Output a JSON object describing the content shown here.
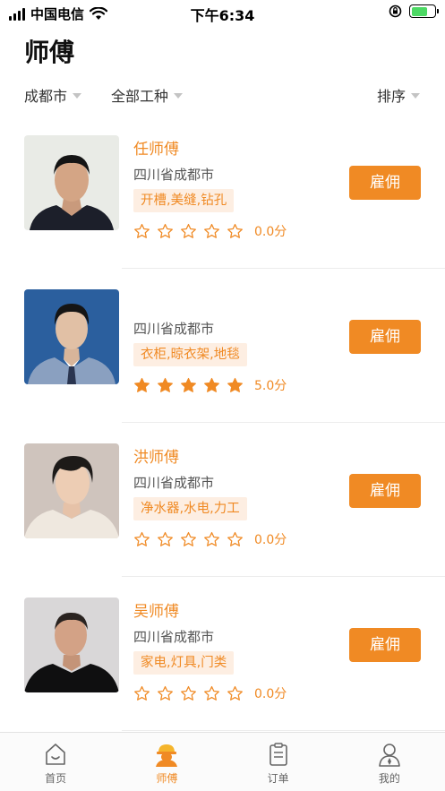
{
  "status_bar": {
    "carrier": "中国电信",
    "time": "下午6:34"
  },
  "header": {
    "title": "师傅"
  },
  "filters": {
    "city": "成都市",
    "trade": "全部工种",
    "sort": "排序"
  },
  "colors": {
    "accent": "#f08a24",
    "tag_bg": "#fdeee2"
  },
  "workers": [
    {
      "name": "任师傅",
      "location": "四川省成都市",
      "tags": "开槽,美缝,钻孔",
      "stars": 0,
      "score": "0.0分",
      "button": "雇佣"
    },
    {
      "name": "",
      "location": "四川省成都市",
      "tags": "衣柜,晾衣架,地毯",
      "stars": 5,
      "score": "5.0分",
      "button": "雇佣"
    },
    {
      "name": "洪师傅",
      "location": "四川省成都市",
      "tags": "净水器,水电,力工",
      "stars": 0,
      "score": "0.0分",
      "button": "雇佣"
    },
    {
      "name": "吴师傅",
      "location": "四川省成都市",
      "tags": "家电,灯具,门类",
      "stars": 0,
      "score": "0.0分",
      "button": "雇佣"
    }
  ],
  "tabs": [
    {
      "label": "首页",
      "icon": "home-icon"
    },
    {
      "label": "师傅",
      "icon": "worker-icon"
    },
    {
      "label": "订单",
      "icon": "order-clipboard-icon"
    },
    {
      "label": "我的",
      "icon": "profile-icon"
    }
  ]
}
